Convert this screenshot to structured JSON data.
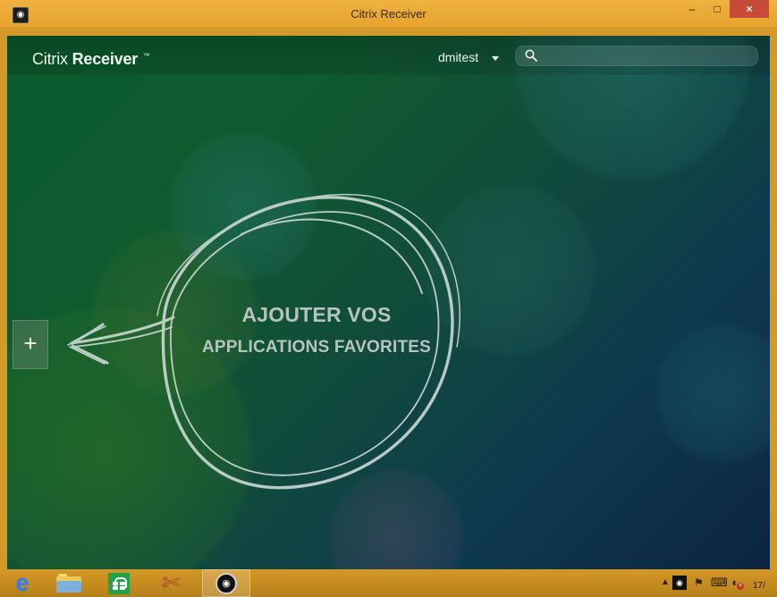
{
  "window": {
    "title": "Citrix Receiver",
    "controls": {
      "minimize": "‒",
      "maximize": "□",
      "close": "×"
    }
  },
  "header": {
    "brand_light": "Citrix",
    "brand_bold": "Receiver",
    "brand_mark": "™",
    "user": "dmitest",
    "search": {
      "value": "",
      "placeholder": ""
    }
  },
  "main": {
    "add_button": "+",
    "promo_line1": "AJOUTER VOS",
    "promo_line2": "APPLICATIONS FAVORITES"
  },
  "taskbar": {
    "apps": [
      {
        "name": "Internet Explorer",
        "icon": "internet-explorer-icon"
      },
      {
        "name": "File Explorer",
        "icon": "folder-icon"
      },
      {
        "name": "Store",
        "icon": "store-icon"
      },
      {
        "name": "Tool",
        "icon": "tool-icon"
      },
      {
        "name": "Citrix Receiver",
        "icon": "citrix-receiver-icon"
      }
    ],
    "tray": {
      "clock_fragment": "17/"
    }
  },
  "colors": {
    "title_bar": "#e6a32e",
    "taskbar": "#b67f19",
    "accent_green": "#0f5b2f",
    "close_button": "#c84b3a"
  }
}
